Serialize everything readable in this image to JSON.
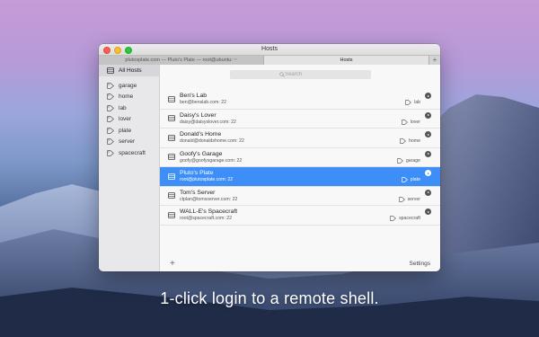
{
  "window": {
    "title": "Hosts",
    "tabs": [
      {
        "label": "plutosplate.com — Pluto's Plate — root@ubuntu: ~",
        "active": false
      },
      {
        "label": "Hosts",
        "active": true
      }
    ],
    "add_tab_label": "+"
  },
  "sidebar": {
    "all_hosts_label": "All Hosts",
    "tags": [
      {
        "label": "garage"
      },
      {
        "label": "home"
      },
      {
        "label": "lab"
      },
      {
        "label": "lover"
      },
      {
        "label": "plate"
      },
      {
        "label": "server"
      },
      {
        "label": "spacecraft"
      }
    ]
  },
  "search": {
    "placeholder": "Search"
  },
  "hosts": [
    {
      "name": "Ben's Lab",
      "address": "ben@benslab.com: 22",
      "tag": "lab",
      "selected": false
    },
    {
      "name": "Daisy's Lover",
      "address": "daisy@daisyslover.com: 22",
      "tag": "lover",
      "selected": false
    },
    {
      "name": "Donald's Home",
      "address": "donald@donaldshome.com: 22",
      "tag": "home",
      "selected": false
    },
    {
      "name": "Goofy's Garage",
      "address": "goofy@goofysgarage.com: 22",
      "tag": "garage",
      "selected": false
    },
    {
      "name": "Pluto's Plate",
      "address": "root@plutosplate.com: 22",
      "tag": "plate",
      "selected": true
    },
    {
      "name": "Tom's Server",
      "address": "ctplan@tomsserver.com: 22",
      "tag": "server",
      "selected": false
    },
    {
      "name": "WALL-E's Spacecraft",
      "address": "root@spacecraft.com: 22",
      "tag": "spacecraft",
      "selected": false
    }
  ],
  "footer": {
    "add_label": "+",
    "settings_label": "Settings"
  },
  "caption": "1-click login to a remote shell.",
  "colors": {
    "selection": "#3d8ff7",
    "close": "#fc5f57",
    "minimize": "#fdbc2e",
    "zoom": "#28c840"
  }
}
